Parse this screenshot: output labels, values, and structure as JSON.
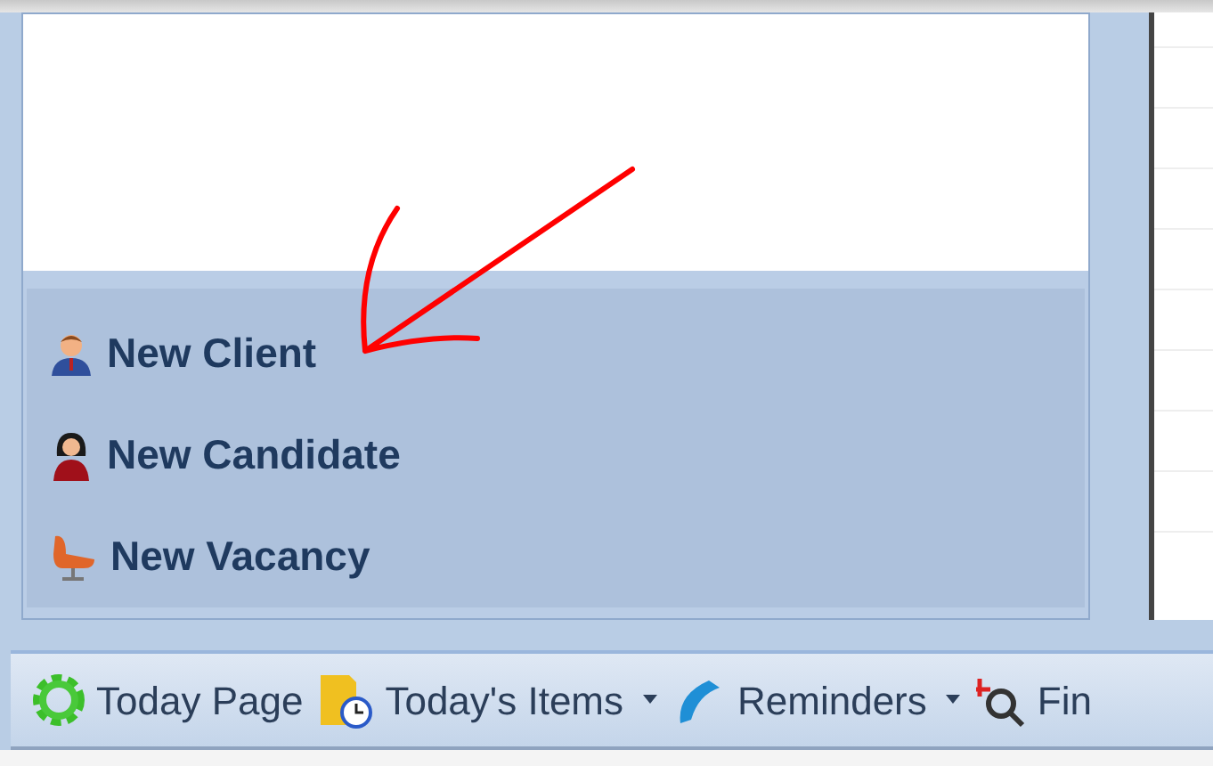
{
  "shortcuts": [
    {
      "kind": "client",
      "label": "New Client"
    },
    {
      "kind": "candidate",
      "label": "New Candidate"
    },
    {
      "kind": "vacancy",
      "label": "New Vacancy"
    }
  ],
  "toolbar": [
    {
      "kind": "gear",
      "label": "Today Page",
      "dropdown": false
    },
    {
      "kind": "folder",
      "label": "Today's Items",
      "dropdown": true
    },
    {
      "kind": "phone",
      "label": "Reminders",
      "dropdown": true
    },
    {
      "kind": "find",
      "label": "Fin",
      "dropdown": false
    }
  ]
}
